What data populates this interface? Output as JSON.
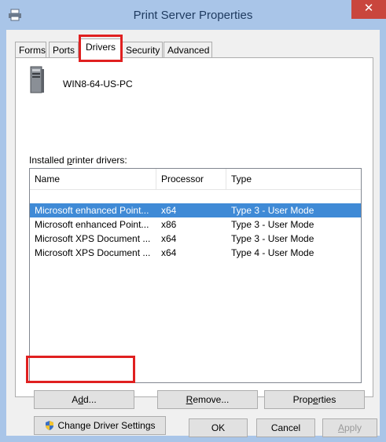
{
  "window": {
    "title": "Print Server Properties",
    "close_glyph": "✕"
  },
  "tabs": [
    {
      "label": "Forms"
    },
    {
      "label": "Ports"
    },
    {
      "label": "Drivers"
    },
    {
      "label": "Security"
    },
    {
      "label": "Advanced"
    }
  ],
  "active_tab": "Drivers",
  "server": {
    "name": "WIN8-64-US-PC",
    "icon": "server-icon"
  },
  "drivers": {
    "label": "Installed printer drivers:",
    "columns": [
      "Name",
      "Processor",
      "Type"
    ],
    "rows": [
      {
        "name": "Microsoft enhanced Point...",
        "processor": "x64",
        "type": "Type 3 - User Mode",
        "selected": true
      },
      {
        "name": "Microsoft enhanced Point...",
        "processor": "x86",
        "type": "Type 3 - User Mode",
        "selected": false
      },
      {
        "name": "Microsoft XPS Document ...",
        "processor": "x64",
        "type": "Type 3 - User Mode",
        "selected": false
      },
      {
        "name": "Microsoft XPS Document ...",
        "processor": "x64",
        "type": "Type 4 - User Mode",
        "selected": false
      }
    ]
  },
  "buttons": {
    "add": "Add...",
    "remove": "Remove...",
    "properties": "Properties",
    "change_driver_settings": "Change Driver Settings",
    "ok": "OK",
    "cancel": "Cancel",
    "apply": "Apply"
  },
  "colors": {
    "title_bar": "#a9c5e8",
    "close_button": "#c9463d",
    "selection": "#3f8ad6",
    "highlight_box": "#e02020"
  }
}
